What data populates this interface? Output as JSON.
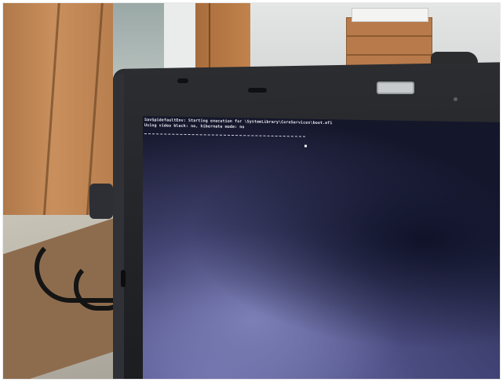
{
  "photo": {
    "subject": "laptop-boot-console",
    "console_lines": [
      "SavSpidefaultEnv: Starting execution for \\SystemLibrary\\CoreServices\\boot.efi",
      "Using video black: no, hibernate mode: no"
    ]
  }
}
